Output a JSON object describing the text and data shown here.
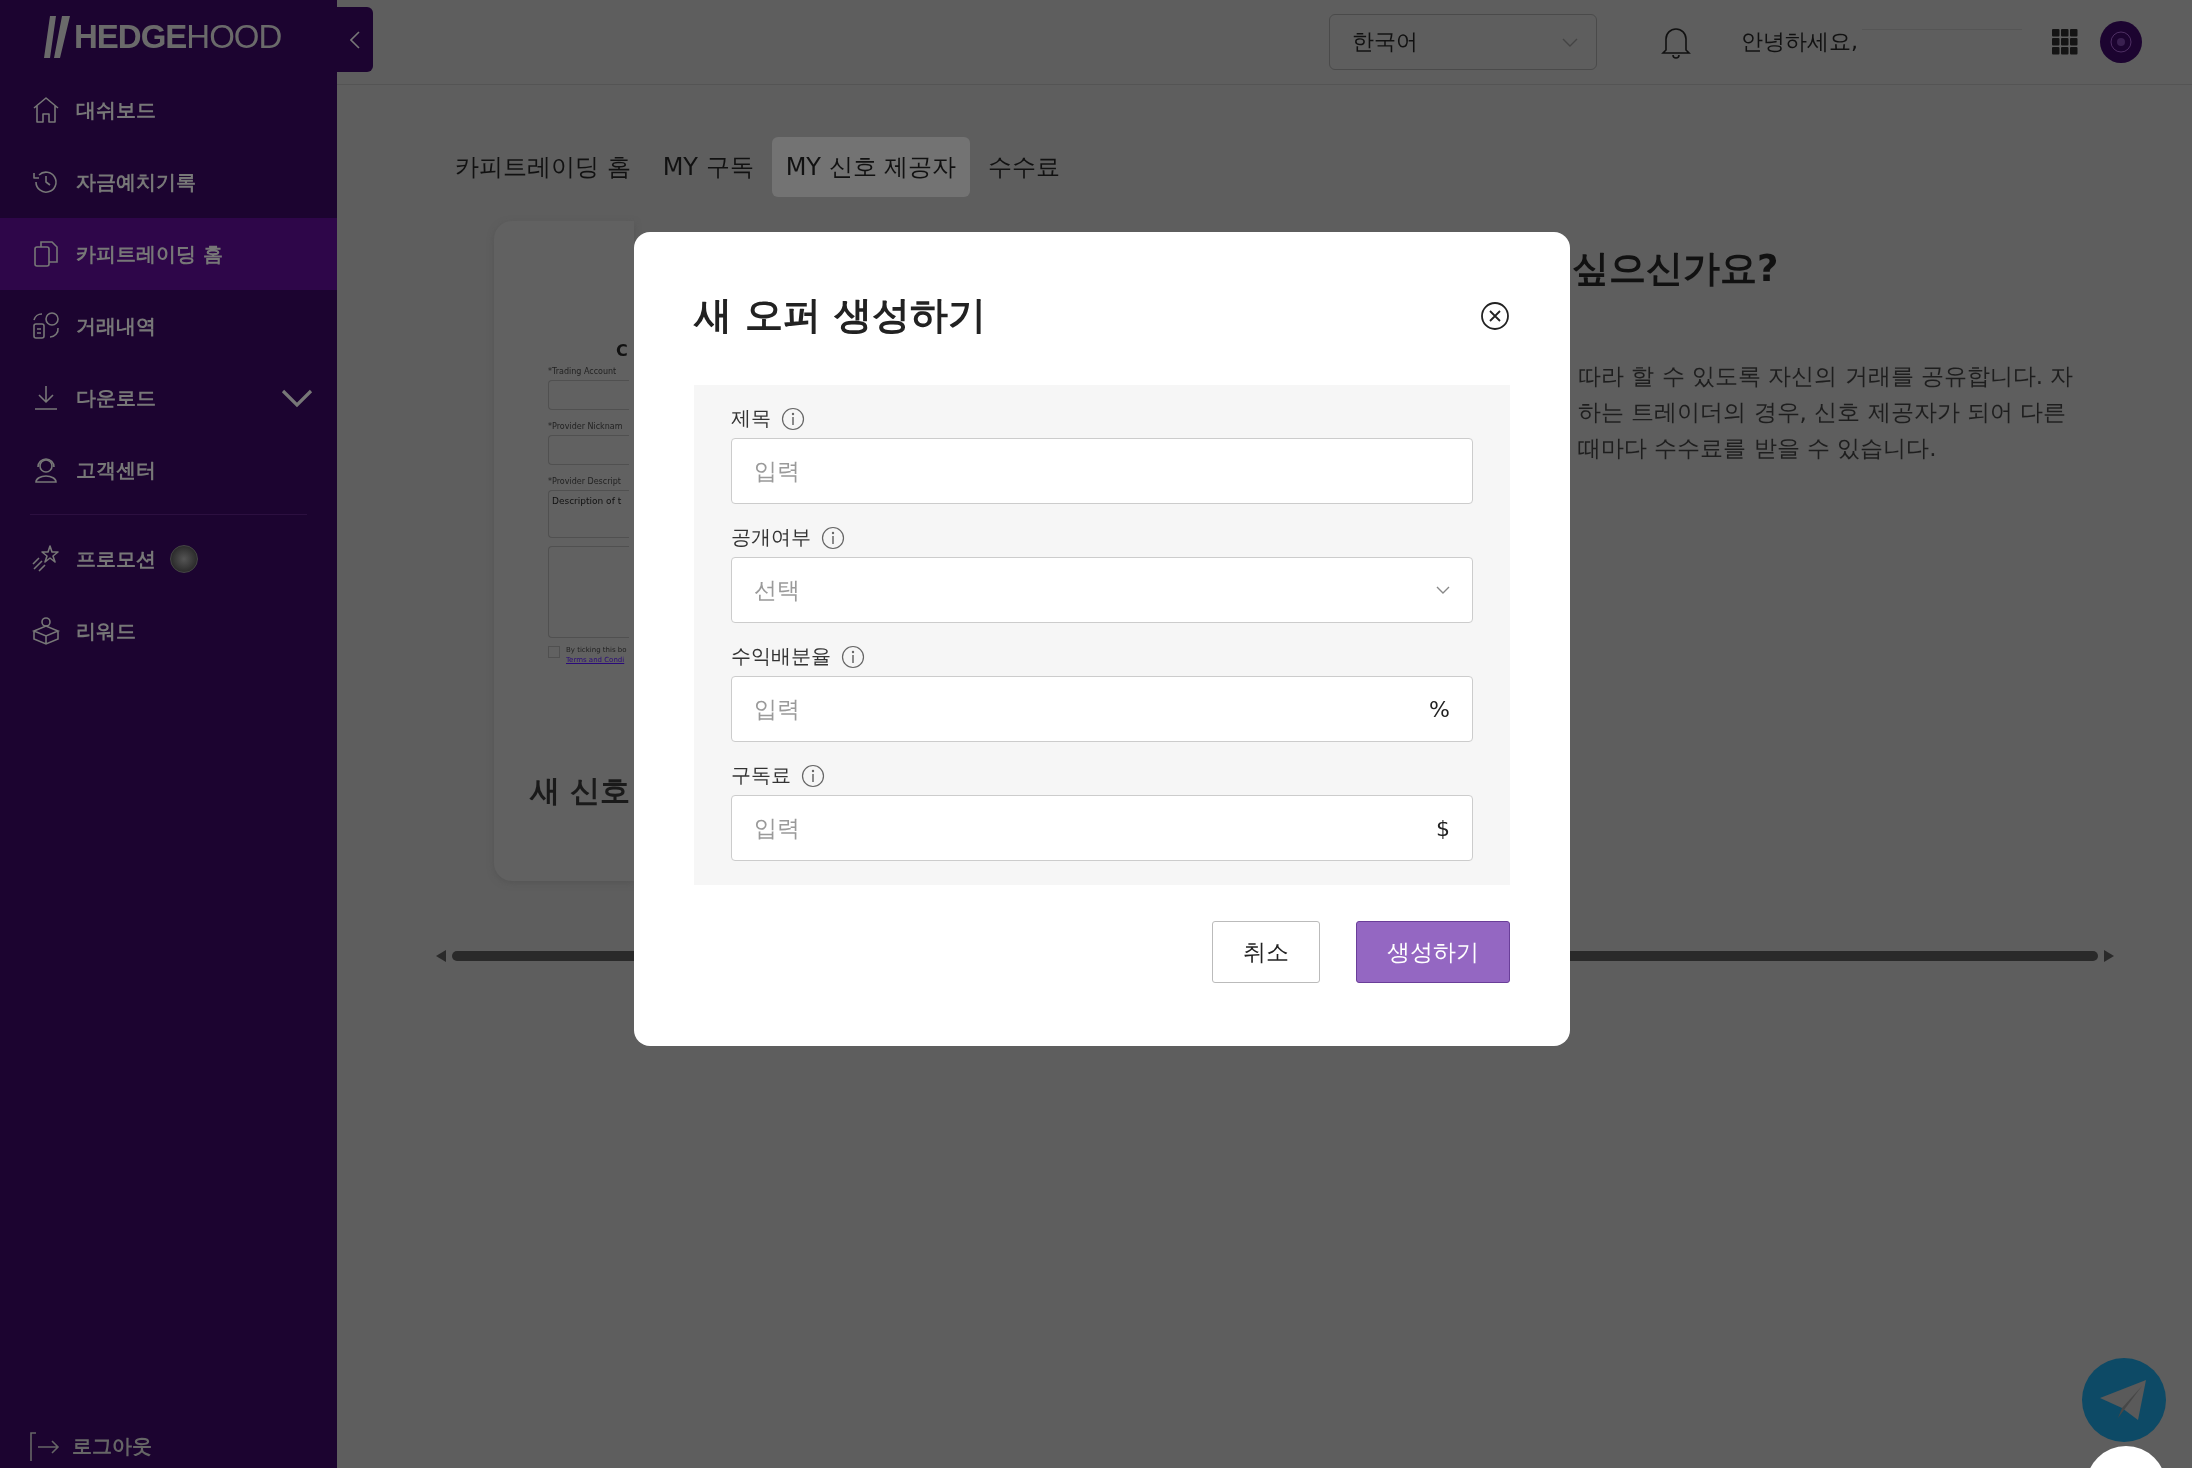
{
  "sidebar": {
    "logo": "**HEDGE**HOOD",
    "items": [
      {
        "label": "대쉬보드",
        "kind": "link",
        "selected": false
      },
      {
        "label": "자금예치기록",
        "kind": "link",
        "selected": false
      },
      {
        "label": "카피트레이딩 홈",
        "kind": "link",
        "selected": true
      },
      {
        "label": "거래내역",
        "kind": "link",
        "selected": false
      },
      {
        "label": "다운로드",
        "kind": "group",
        "selected": false
      },
      {
        "label": "고객센터",
        "kind": "link",
        "selected": false
      },
      {
        "label": "프로모션",
        "kind": "promo",
        "selected": false
      },
      {
        "label": "리워드",
        "kind": "link",
        "selected": false
      }
    ],
    "logout": "로그아웃"
  },
  "header": {
    "language": "한국어",
    "greeting": "안녕하세요,"
  },
  "tabs": [
    {
      "label": "카피트레이딩 홈",
      "selected": false
    },
    {
      "label": "MY 구독",
      "selected": false
    },
    {
      "label": "MY 신호 제공자",
      "selected": true
    },
    {
      "label": "수수료",
      "selected": false
    }
  ],
  "card": {
    "form_title": "C",
    "fields": [
      "*Trading Account",
      "*Provider Nicknam",
      "*Provider Descript"
    ],
    "description_placeholder": "Description of t",
    "consent_checked": false,
    "consent_text": "By ticking this bo",
    "consent_link": "Terms and Condi",
    "heading": "새 신호"
  },
  "intro": {
    "heading": "싶으신가요?",
    "lines": [
      "따라 할 수 있도록 자신의 거래를 공유합니다. 자",
      "하는 트레이더의 경우, 신호 제공자가 되어 다른",
      "때마다 수수료를 받을 수 있습니다."
    ]
  },
  "modal": {
    "title": "새 오퍼 생성하기",
    "fields": [
      {
        "label": "제목",
        "kind": "text",
        "placeholder": "입력"
      },
      {
        "label": "공개여부",
        "kind": "select",
        "placeholder": "선택"
      },
      {
        "label": "수익배분율",
        "kind": "text",
        "placeholder": "입력",
        "suffix": "%"
      },
      {
        "label": "구독료",
        "kind": "text",
        "placeholder": "입력",
        "suffix": "$"
      }
    ],
    "buttons": [
      {
        "label": "취소",
        "kind": "secondary"
      },
      {
        "label": "생성하기",
        "kind": "primary"
      }
    ]
  }
}
